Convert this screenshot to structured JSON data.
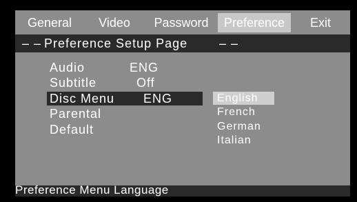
{
  "tabs": [
    {
      "label": "General"
    },
    {
      "label": "Video"
    },
    {
      "label": "Password"
    },
    {
      "label": "Preference",
      "active": true
    },
    {
      "label": "Exit"
    }
  ],
  "title": {
    "dash_left": "– –",
    "text": "Preference Setup Page",
    "dash_right": "– –"
  },
  "menu": {
    "items": [
      {
        "label": "Audio",
        "value": "ENG"
      },
      {
        "label": "Subtitle",
        "value": "Off"
      },
      {
        "label": "Disc Menu",
        "value": "ENG",
        "selected": true
      },
      {
        "label": "Parental",
        "value": ""
      },
      {
        "label": "Default",
        "value": ""
      }
    ]
  },
  "options": {
    "items": [
      "English",
      "French",
      "German",
      "Italian"
    ],
    "highlighted": "English"
  },
  "status": {
    "text": "Preference Menu Language"
  },
  "colors": {
    "panel_bg": "#8c8c8c",
    "dark_bar": "#2a2a2a",
    "active_tab": "#c8c8c8",
    "option_highlight": "#cfcfcf",
    "text": "#ffffff"
  }
}
